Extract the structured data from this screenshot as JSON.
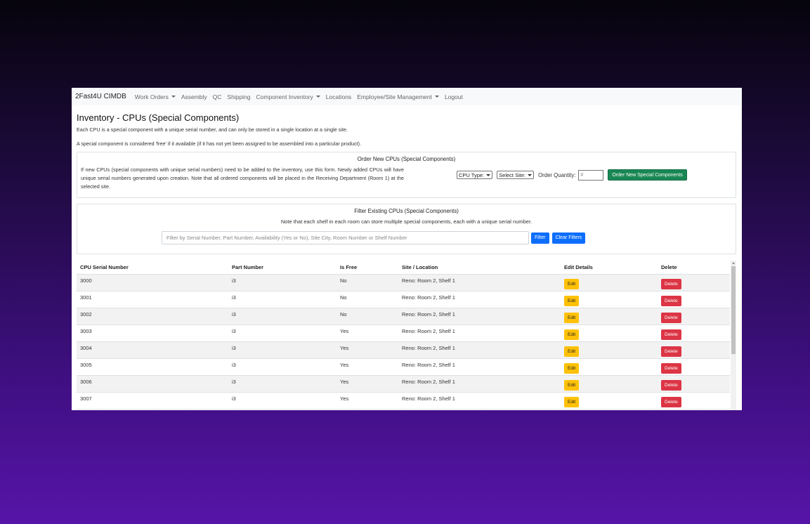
{
  "navbar": {
    "brand": "2Fast4U CIMDB",
    "items": [
      {
        "label": "Work Orders",
        "dropdown": true
      },
      {
        "label": "Assembly",
        "dropdown": false
      },
      {
        "label": "QC",
        "dropdown": false
      },
      {
        "label": "Shipping",
        "dropdown": false
      },
      {
        "label": "Component Inventory",
        "dropdown": true
      },
      {
        "label": "Locations",
        "dropdown": false
      },
      {
        "label": "Employee/Site Management",
        "dropdown": true
      },
      {
        "label": "Logout",
        "dropdown": false
      }
    ]
  },
  "page": {
    "title": "Inventory - CPUs (Special Components)",
    "intro1": "Each CPU is a special component with a unique serial number, and can only be stored in a single location at a single site.",
    "intro2": "A special component is considered 'free' if it available (if it has not yet been assigned to be assembled into a particular product)."
  },
  "order": {
    "title": "Order New CPUs (Special Components)",
    "description": "If new CPUs (special components with unique serial numbers) need to be added to the inventory, use this form. Newly added CPUs will have unique serial numbers generated upon creation. Note that all ordered components will be placed in the Receiving Department (Room 1) at the selected site.",
    "cpu_type_select": "CPU Type:",
    "site_select": "Select Site:",
    "quantity_label": "Order Quantity:",
    "quantity_placeholder": "#",
    "submit_label": "Order New Special Components"
  },
  "filter": {
    "title": "Filter Existing CPUs (Special Components)",
    "note": "Note that each shelf in each room can store multiple special components, each with a unique serial number.",
    "placeholder": "Filter by Serial Number, Part Number, Availability (Yes or No), Site City, Room Number or Shelf Number",
    "filter_label": "Filter",
    "clear_label": "Clear Filters"
  },
  "table": {
    "headers": [
      "CPU Serial Number",
      "Part Number",
      "Is Free",
      "Site / Location",
      "Edit Details",
      "Delete"
    ],
    "edit_label": "Edit",
    "delete_label": "Delete",
    "rows": [
      {
        "serial": "3000",
        "part": "i3",
        "free": "No",
        "location": "Reno: Room 2, Shelf 1"
      },
      {
        "serial": "3001",
        "part": "i3",
        "free": "No",
        "location": "Reno: Room 2, Shelf 1"
      },
      {
        "serial": "3002",
        "part": "i3",
        "free": "No",
        "location": "Reno: Room 2, Shelf 1"
      },
      {
        "serial": "3003",
        "part": "i3",
        "free": "Yes",
        "location": "Reno: Room 2, Shelf 1"
      },
      {
        "serial": "3004",
        "part": "i3",
        "free": "Yes",
        "location": "Reno: Room 2, Shelf 1"
      },
      {
        "serial": "3005",
        "part": "i3",
        "free": "Yes",
        "location": "Reno: Room 2, Shelf 1"
      },
      {
        "serial": "3006",
        "part": "i3",
        "free": "Yes",
        "location": "Reno: Room 2, Shelf 1"
      },
      {
        "serial": "3007",
        "part": "i3",
        "free": "Yes",
        "location": "Reno: Room 2, Shelf 1"
      }
    ]
  }
}
